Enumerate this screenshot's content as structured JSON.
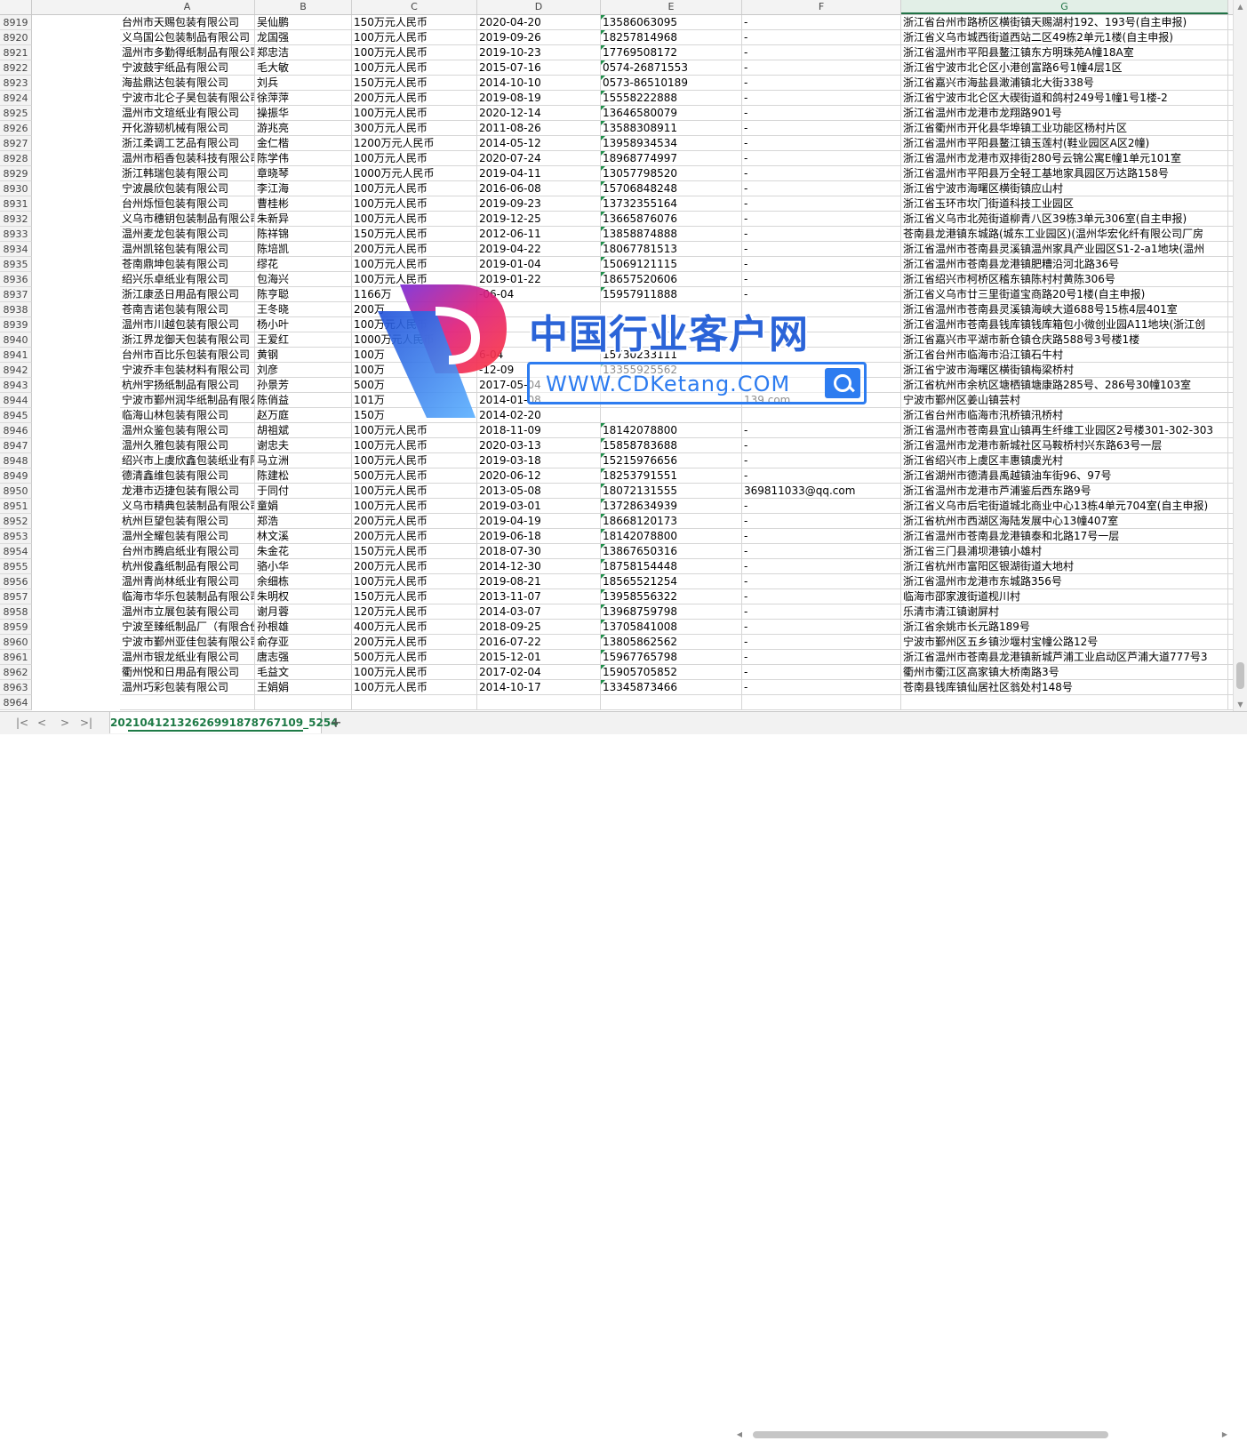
{
  "columns": [
    "A",
    "B",
    "C",
    "D",
    "E",
    "F",
    "G"
  ],
  "selected_column": "G",
  "rows": [
    {
      "n": "8919",
      "a": "台州市天赐包装有限公司",
      "b": "吴仙鹏",
      "c": "150万元人民币",
      "d": "2020-04-20",
      "e": "13586063095",
      "f": "-",
      "g": "浙江省台州市路桥区横街镇天赐湖村192、193号(自主申报)"
    },
    {
      "n": "8920",
      "a": "义乌国公包装制品有限公司",
      "b": "龙国强",
      "c": "100万元人民币",
      "d": "2019-09-26",
      "e": "18257814968",
      "f": "-",
      "g": "浙江省义乌市城西街道西站二区49栋2单元1楼(自主申报)"
    },
    {
      "n": "8921",
      "a": "温州市多勤得纸制品有限公司",
      "b": "郑忠洁",
      "c": "100万元人民币",
      "d": "2019-10-23",
      "e": "17769508172",
      "f": "-",
      "g": "浙江省温州市平阳县鳌江镇东方明珠苑A幢18A室"
    },
    {
      "n": "8922",
      "a": "宁波鼓宇纸品有限公司",
      "b": "毛大敏",
      "c": "100万元人民币",
      "d": "2015-07-16",
      "e": "0574-26871553",
      "f": "-",
      "g": "浙江省宁波市北仑区小港创富路6号1幢4层1区"
    },
    {
      "n": "8923",
      "a": "海盐鼎达包装有限公司",
      "b": "刘兵",
      "c": "150万元人民币",
      "d": "2014-10-10",
      "e": "0573-86510189",
      "f": "-",
      "g": "浙江省嘉兴市海盐县澉浦镇北大街338号"
    },
    {
      "n": "8924",
      "a": "宁波市北仑子昊包装有限公司",
      "b": "徐萍萍",
      "c": "200万元人民币",
      "d": "2019-08-19",
      "e": "15558222888",
      "f": "-",
      "g": "浙江省宁波市北仑区大碶街道和鸽村249号1幢1号1楼-2"
    },
    {
      "n": "8925",
      "a": "温州市文瑄纸业有限公司",
      "b": "操振华",
      "c": "100万元人民币",
      "d": "2020-12-14",
      "e": "13646580079",
      "f": "-",
      "g": "浙江省温州市龙港市龙翔路901号"
    },
    {
      "n": "8926",
      "a": "开化游韧机械有限公司",
      "b": "游兆亮",
      "c": "300万元人民币",
      "d": "2011-08-26",
      "e": "13588308911",
      "f": "-",
      "g": "浙江省衢州市开化县华埠镇工业功能区杨村片区"
    },
    {
      "n": "8927",
      "a": "浙江柔调工艺品有限公司",
      "b": "金仁楷",
      "c": "1200万元人民币",
      "d": "2014-05-12",
      "e": "13958934534",
      "f": "-",
      "g": "浙江省温州市平阳县鳌江镇玉莲村(鞋业园区A区2幢)"
    },
    {
      "n": "8928",
      "a": "温州市稻香包装科技有限公司",
      "b": "陈学伟",
      "c": "100万元人民币",
      "d": "2020-07-24",
      "e": "18968774997",
      "f": "-",
      "g": "浙江省温州市龙港市双排街280号云锦公寓E幢1单元101室"
    },
    {
      "n": "8929",
      "a": "浙江韩瑞包装有限公司",
      "b": "章晓琴",
      "c": "1000万元人民币",
      "d": "2019-04-11",
      "e": "13057798520",
      "f": "-",
      "g": "浙江省温州市平阳县万全轻工基地家具园区万达路158号"
    },
    {
      "n": "8930",
      "a": "宁波晨欣包装有限公司",
      "b": "李江海",
      "c": "100万元人民币",
      "d": "2016-06-08",
      "e": "15706848248",
      "f": "-",
      "g": "浙江省宁波市海曙区横街镇应山村"
    },
    {
      "n": "8931",
      "a": "台州烁恒包装有限公司",
      "b": "曹桂彬",
      "c": "100万元人民币",
      "d": "2019-09-23",
      "e": "13732355164",
      "f": "-",
      "g": "浙江省玉环市坎门街道科技工业园区"
    },
    {
      "n": "8932",
      "a": "义乌市穗钥包装制品有限公司",
      "b": "朱新异",
      "c": "100万元人民币",
      "d": "2019-12-25",
      "e": "13665876076",
      "f": "-",
      "g": "浙江省义乌市北苑街道柳青八区39栋3单元306室(自主申报)"
    },
    {
      "n": "8933",
      "a": "温州麦龙包装有限公司",
      "b": "陈祥锦",
      "c": "150万元人民币",
      "d": "2012-06-11",
      "e": "13858874888",
      "f": "-",
      "g": "苍南县龙港镇东城路(城东工业园区)(温州华宏化纤有限公司厂房"
    },
    {
      "n": "8934",
      "a": "温州凯铭包装有限公司",
      "b": "陈培凯",
      "c": "200万元人民币",
      "d": "2019-04-22",
      "e": "18067781513",
      "f": "-",
      "g": "浙江省温州市苍南县灵溪镇温州家具产业园区S1-2-a1地块(温州"
    },
    {
      "n": "8935",
      "a": "苍南鼎坤包装有限公司",
      "b": "缪花",
      "c": "100万元人民币",
      "d": "2019-01-04",
      "e": "15069121115",
      "f": "-",
      "g": "浙江省温州市苍南县龙港镇肥糟沿河北路36号"
    },
    {
      "n": "8936",
      "a": "绍兴乐卓纸业有限公司",
      "b": "包海兴",
      "c": "100万元人民币",
      "d": "2019-01-22",
      "e": "18657520606",
      "f": "-",
      "g": "浙江省绍兴市柯桥区稽东镇陈村村黄陈306号"
    },
    {
      "n": "8937",
      "a": "浙江康丞日用品有限公司",
      "b": "陈亨聪",
      "c": "1166万",
      "d": "-06-04",
      "e": "15957911888",
      "f": "-",
      "g": "浙江省义乌市廿三里街道宝商路20号1楼(自主申报)"
    },
    {
      "n": "8938",
      "a": "苍南吉诺包装有限公司",
      "b": "王冬晓",
      "c": "200万",
      "d": "",
      "e": "",
      "f": "",
      "g": "浙江省温州市苍南县灵溪镇海峡大道688号15栋4层401室"
    },
    {
      "n": "8939",
      "a": "温州市川越包装有限公司",
      "b": "杨小叶",
      "c": "100万元人民币",
      "d": "",
      "e": "",
      "f": "",
      "g": "浙江省温州市苍南县钱库镇钱库箱包小微创业园A11地块(浙江创"
    },
    {
      "n": "8940",
      "a": "浙江界龙御天包装有限公司",
      "b": "王爱红",
      "c": "1000万元人民币",
      "d": "",
      "e": "",
      "f": "",
      "g": "浙江省嘉兴市平湖市新仓镇仓庆路588号3号楼1楼"
    },
    {
      "n": "8941",
      "a": "台州市百比乐包装有限公司",
      "b": "黄钢",
      "c": "100万",
      "d": "6-04",
      "e": "15730233111",
      "f": "",
      "g": "浙江省台州市临海市沿江镇石牛村"
    },
    {
      "n": "8942",
      "a": "宁波乔丰包装材料有限公司",
      "b": "刘彦",
      "c": "100万",
      "d": "-12-09",
      "e": "13355925562",
      "f": "",
      "g": "浙江省宁波市海曙区横街镇梅梁桥村"
    },
    {
      "n": "8943",
      "a": "杭州宇扬纸制品有限公司",
      "b": "孙景芳",
      "c": "500万",
      "d": "2017-05-04",
      "e": "",
      "f": "",
      "g": "浙江省杭州市余杭区塘栖镇塘康路285号、286号30幢103室"
    },
    {
      "n": "8944",
      "a": "宁波市鄞州润华纸制品有限公司",
      "b": "陈俏益",
      "c": "101万",
      "d": "2014-01-08",
      "e": "",
      "f": "139.com",
      "g": "宁波市鄞州区姜山镇芸村"
    },
    {
      "n": "8945",
      "a": "临海山林包装有限公司",
      "b": "赵万庭",
      "c": "150万",
      "d": "2014-02-20",
      "e": "",
      "f": "",
      "g": "浙江省台州市临海市汛桥镇汛桥村"
    },
    {
      "n": "8946",
      "a": "温州众鉴包装有限公司",
      "b": "胡祖斌",
      "c": "100万元人民币",
      "d": "2018-11-09",
      "e": "18142078800",
      "f": "-",
      "g": "浙江省温州市苍南县宜山镇再生纤维工业园区2号楼301-302-303"
    },
    {
      "n": "8947",
      "a": "温州久雅包装有限公司",
      "b": "谢忠夫",
      "c": "100万元人民币",
      "d": "2020-03-13",
      "e": "15858783688",
      "f": "-",
      "g": "浙江省温州市龙港市新城社区马鞍桥村兴东路63号一层"
    },
    {
      "n": "8948",
      "a": "绍兴市上虞欣鑫包装纸业有限公司",
      "b": "马立洲",
      "c": "100万元人民币",
      "d": "2019-03-18",
      "e": "15215976656",
      "f": "-",
      "g": "浙江省绍兴市上虞区丰惠镇虞光村"
    },
    {
      "n": "8949",
      "a": "德清鑫维包装有限公司",
      "b": "陈建松",
      "c": "500万元人民币",
      "d": "2020-06-12",
      "e": "18253791551",
      "f": "-",
      "g": "浙江省湖州市德清县禹越镇油车街96、97号"
    },
    {
      "n": "8950",
      "a": "龙港市迈捷包装有限公司",
      "b": "于同付",
      "c": "100万元人民币",
      "d": "2013-05-08",
      "e": "18072131555",
      "f": "369811033@qq.com",
      "g": "浙江省温州市龙港市芦浦鉴后西东路9号"
    },
    {
      "n": "8951",
      "a": "义乌市精典包装制品有限公司",
      "b": "童娟",
      "c": "100万元人民币",
      "d": "2019-03-01",
      "e": "13728634939",
      "f": "-",
      "g": "浙江省义乌市后宅街道城北商业中心13栋4单元704室(自主申报)"
    },
    {
      "n": "8952",
      "a": "杭州巨望包装有限公司",
      "b": "郑浩",
      "c": "200万元人民币",
      "d": "2019-04-19",
      "e": "18668120173",
      "f": "-",
      "g": "浙江省杭州市西湖区海陆发展中心13幢407室"
    },
    {
      "n": "8953",
      "a": "温州全耀包装有限公司",
      "b": "林文溪",
      "c": "200万元人民币",
      "d": "2019-06-18",
      "e": "18142078800",
      "f": "-",
      "g": "浙江省温州市苍南县龙港镇泰和北路17号一层"
    },
    {
      "n": "8954",
      "a": "台州市腾启纸业有限公司",
      "b": "朱金花",
      "c": "150万元人民币",
      "d": "2018-07-30",
      "e": "13867650316",
      "f": "-",
      "g": "浙江省三门县浦坝港镇小雄村"
    },
    {
      "n": "8955",
      "a": "杭州俊鑫纸制品有限公司",
      "b": "骆小华",
      "c": "200万元人民币",
      "d": "2014-12-30",
      "e": "18758154448",
      "f": "-",
      "g": "浙江省杭州市富阳区银湖街道大地村"
    },
    {
      "n": "8956",
      "a": "温州青尚林纸业有限公司",
      "b": "余细栋",
      "c": "100万元人民币",
      "d": "2019-08-21",
      "e": "18565521254",
      "f": "-",
      "g": "浙江省温州市龙港市东城路356号"
    },
    {
      "n": "8957",
      "a": "临海市华乐包装制品有限公司",
      "b": "朱明权",
      "c": "150万元人民币",
      "d": "2013-11-07",
      "e": "13958556322",
      "f": "-",
      "g": "临海市邵家渡街道枧川村"
    },
    {
      "n": "8958",
      "a": "温州市立展包装有限公司",
      "b": "谢月蓉",
      "c": "120万元人民币",
      "d": "2014-03-07",
      "e": "13968759798",
      "f": "-",
      "g": "乐清市清江镇谢屏村"
    },
    {
      "n": "8959",
      "a": "宁波至臻纸制品厂（有限合伙）",
      "b": "孙根雄",
      "c": "400万元人民币",
      "d": "2018-09-25",
      "e": "13705841008",
      "f": "-",
      "g": "浙江省余姚市长元路189号"
    },
    {
      "n": "8960",
      "a": "宁波市鄞州亚佳包装有限公司",
      "b": "俞存亚",
      "c": "200万元人民币",
      "d": "2016-07-22",
      "e": "13805862562",
      "f": "-",
      "g": "宁波市鄞州区五乡镇沙堰村宝幢公路12号"
    },
    {
      "n": "8961",
      "a": "温州市银龙纸业有限公司",
      "b": "唐志强",
      "c": "500万元人民币",
      "d": "2015-12-01",
      "e": "15967765798",
      "f": "-",
      "g": "浙江省温州市苍南县龙港镇新城芦浦工业启动区芦浦大道777号3"
    },
    {
      "n": "8962",
      "a": "衢州悦和日用品有限公司",
      "b": "毛益文",
      "c": "100万元人民币",
      "d": "2017-02-04",
      "e": "15905705852",
      "f": "-",
      "g": "衢州市衢江区高家镇大桥南路3号"
    },
    {
      "n": "8963",
      "a": "温州巧彩包装有限公司",
      "b": "王娟娟",
      "c": "100万元人民币",
      "d": "2014-10-17",
      "e": "13345873466",
      "f": "-",
      "g": "苍南县钱库镇仙居社区翁处村148号"
    },
    {
      "n": "8964",
      "a": "",
      "b": "",
      "c": "",
      "d": "",
      "e": "",
      "f": "",
      "g": ""
    }
  ],
  "sheet_tab": "20210412132626991878767109_5254",
  "nav": {
    "first": "|<",
    "prev": "<",
    "next": ">",
    "last": ">|",
    "add": "+"
  },
  "watermark": {
    "title": "中国行业客户网",
    "url": "WWW.CDKetang.COM"
  },
  "colors": {
    "accent": "#217346",
    "watermark_blue": "#2b64d8"
  }
}
